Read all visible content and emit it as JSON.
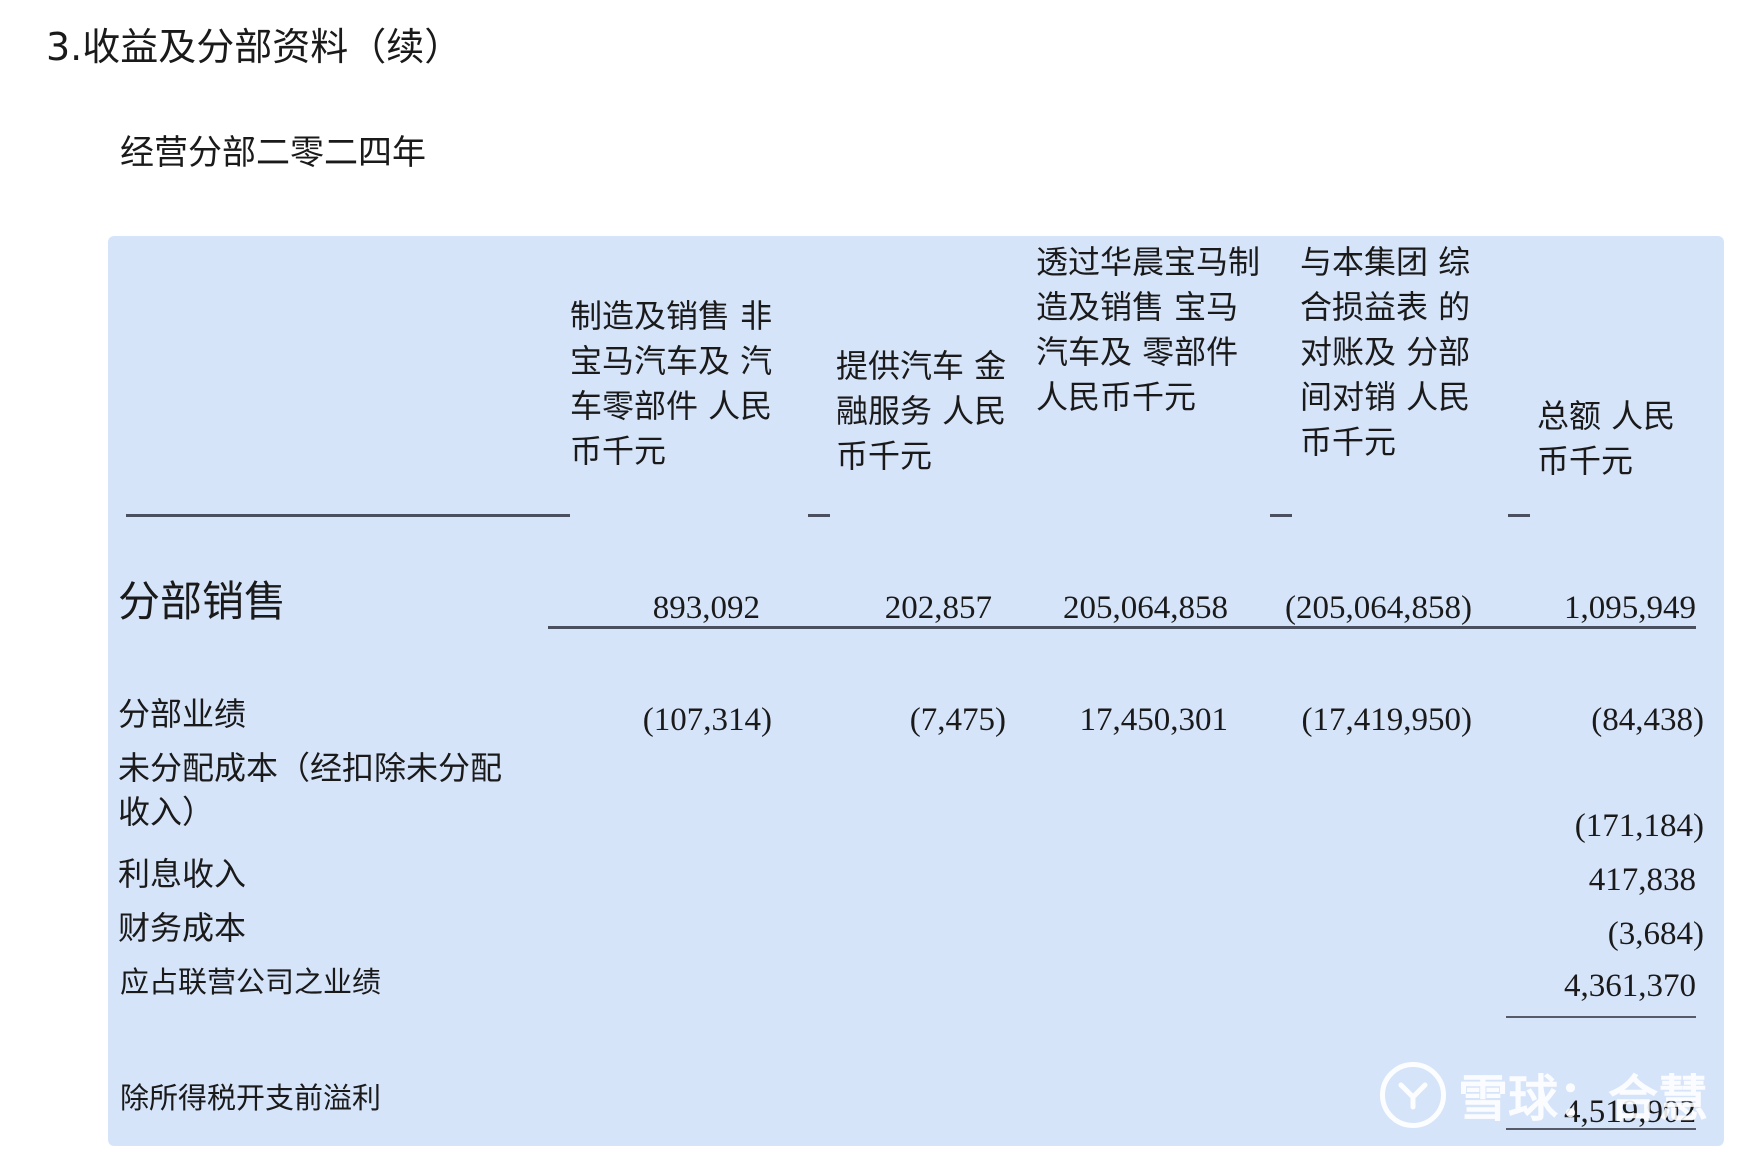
{
  "document": {
    "section_title": "3.收益及分部资料（续）",
    "subtitle": "经营分部二零二四年"
  },
  "table": {
    "columns": [
      "制造及销售 非宝马汽车及 汽车零部件 人民币千元",
      "提供汽车 金融服务 人民币千元",
      "透过华晨宝马制造及销售 宝马汽车及 零部件 人民币千元",
      "与本集团 综合损益表 的对账及 分部间对销 人民币千元",
      "总额 人民币千元"
    ],
    "rows": {
      "segment_sales": {
        "label": "分部销售",
        "values": [
          "893,092",
          "202,857",
          "205,064,858",
          "(205,064,858)",
          "1,095,949"
        ]
      },
      "segment_results": {
        "label": "分部业绩",
        "values": [
          "(107,314)",
          "(7,475)",
          "17,450,301",
          "(17,419,950)",
          "(84,438)"
        ]
      },
      "unallocated_costs": {
        "label_line1": "未分配成本（经扣除未分配",
        "label_line2": "收入）",
        "total": "(171,184)"
      },
      "interest_income": {
        "label": "利息收入",
        "total": "417,838"
      },
      "finance_costs": {
        "label": "财务成本",
        "total": "(3,684)"
      },
      "share_of_associates": {
        "label": "应占联营公司之业绩",
        "total": "4,361,370"
      },
      "profit_before_tax": {
        "label": "除所得税开支前溢利",
        "total": "4,519,902"
      }
    }
  },
  "watermark": {
    "text": "雪球：合慧",
    "icon": "xueqiu-logo-icon"
  }
}
